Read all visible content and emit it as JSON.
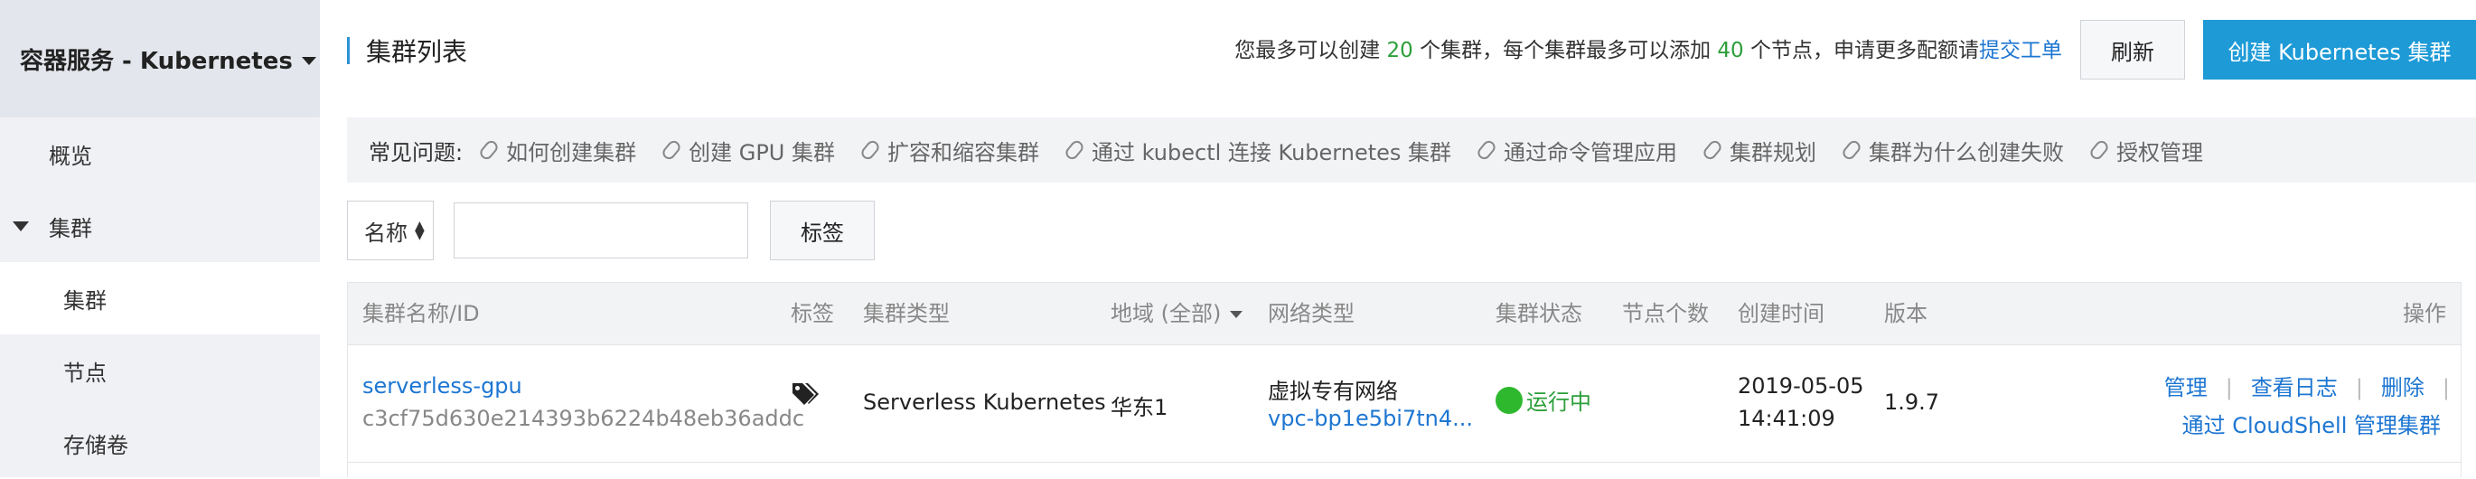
{
  "sidebar": {
    "title": "容器服务 - Kubernetes",
    "items": {
      "overview": "概览",
      "cluster_group": "集群",
      "clusters": "集群",
      "nodes": "节点",
      "volumes": "存储卷"
    }
  },
  "header": {
    "title": "集群列表",
    "quota_prefix": "您最多可以创建",
    "quota_clusters": "20",
    "quota_mid": "个集群，每个集群最多可以添加",
    "quota_nodes": "40",
    "quota_suffix": "个节点，申请更多配额请",
    "quota_link": "提交工单",
    "refresh_label": "刷新",
    "create_label": "创建 Kubernetes 集群"
  },
  "faq": {
    "label": "常见问题:",
    "links": [
      "如何创建集群",
      "创建 GPU 集群",
      "扩容和缩容集群",
      "通过 kubectl 连接 Kubernetes 集群",
      "通过命令管理应用",
      "集群规划",
      "集群为什么创建失败",
      "授权管理"
    ]
  },
  "filter": {
    "select_value": "名称",
    "input_value": "",
    "tag_button": "标签"
  },
  "table": {
    "columns": {
      "name": "集群名称/ID",
      "tags": "标签",
      "type": "集群类型",
      "region": "地域 (全部)",
      "network": "网络类型",
      "status": "集群状态",
      "nodes": "节点个数",
      "created": "创建时间",
      "version": "版本",
      "actions": "操作"
    },
    "rows": [
      {
        "name": "serverless-gpu",
        "id": "c3cf75d630e214393b6224b48eb36addc",
        "type": "Serverless Kubernetes",
        "region": "华东1",
        "network": "虚拟专有网络",
        "vpc": "vpc-bp1e5bi7tn4...",
        "status": "运行中",
        "nodes": "",
        "created_date": "2019-05-05",
        "created_time": "14:41:09",
        "version": "1.9.7",
        "actions": {
          "manage": "管理",
          "logs": "查看日志",
          "delete": "删除",
          "cloudshell": "通过 CloudShell 管理集群"
        }
      }
    ]
  },
  "colors": {
    "accent": "#1e9bd7",
    "link": "#1d76d2",
    "success": "#2eb82e"
  }
}
